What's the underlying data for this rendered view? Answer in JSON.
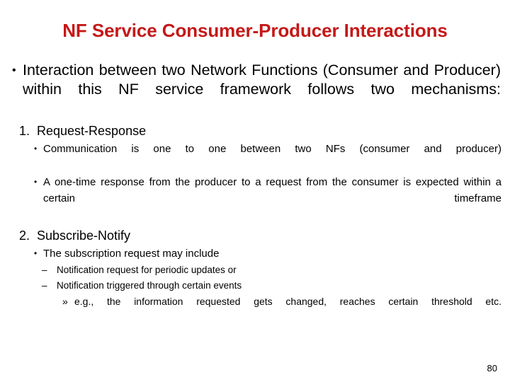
{
  "slide": {
    "title": "NF Service Consumer-Producer Interactions",
    "title_color": "#C51818",
    "background_color": "#FFFFFF",
    "page_number": "80",
    "bullets": {
      "level1_bullet_glyph": "•",
      "level3_bullet_glyph": "•",
      "level4_bullet_glyph": "–",
      "level5_bullet_glyph": "»"
    },
    "content": {
      "intro": "Interaction between two Network Functions (Consumer and Producer) within this NF service framework follows two mechanisms:",
      "mechanism_1": {
        "number": "1.",
        "heading": "Request-Response",
        "points": [
          "Communication is one to one between two NFs (consumer and producer)",
          "A one-time response from the producer to a request from the consumer is expected within a certain timeframe"
        ]
      },
      "mechanism_2": {
        "number": "2.",
        "heading": "Subscribe-Notify",
        "points": [
          "The subscription request may include"
        ],
        "sub_points": [
          "Notification request for periodic updates or",
          "Notification triggered through certain events"
        ],
        "example": "e.g., the information requested gets changed, reaches certain threshold etc."
      }
    }
  }
}
